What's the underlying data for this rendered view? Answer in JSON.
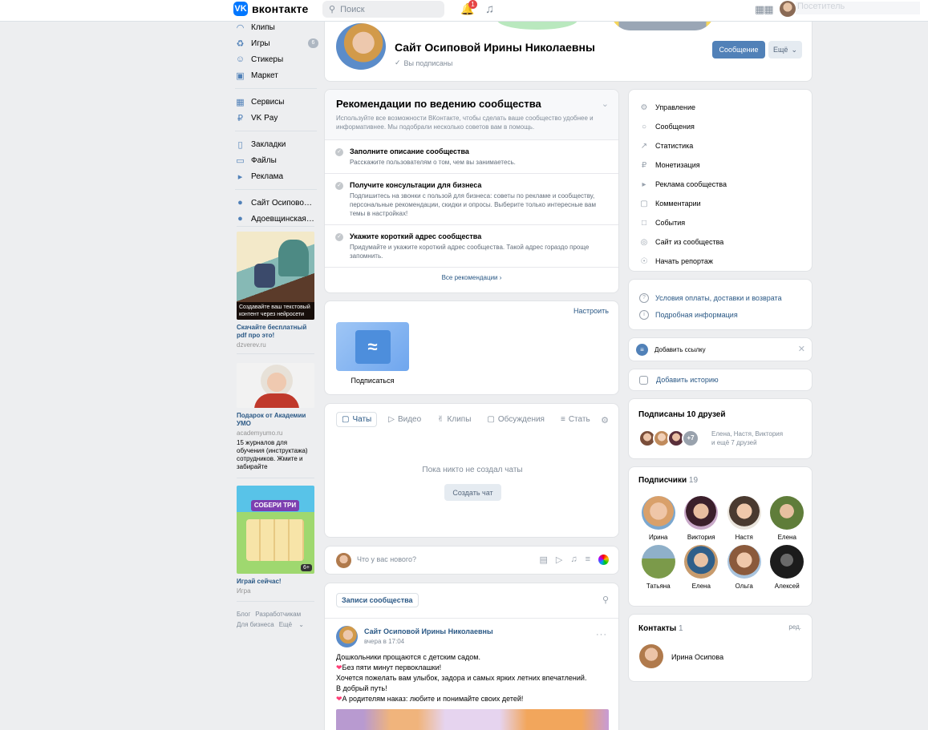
{
  "header": {
    "logo_text": "вконтакте",
    "search_placeholder": "Поиск",
    "notifications_count": "1",
    "user_name": "Посетитель"
  },
  "nav": {
    "items": [
      {
        "label": "Клипы",
        "icon": "clips-icon"
      },
      {
        "label": "Игры",
        "icon": "gamepad-icon",
        "count": "6"
      },
      {
        "label": "Стикеры",
        "icon": "smile-icon"
      },
      {
        "label": "Маркет",
        "icon": "bag-icon"
      },
      {
        "label": "Сервисы",
        "icon": "grid-icon"
      },
      {
        "label": "VK Pay",
        "icon": "pay-icon"
      },
      {
        "label": "Закладки",
        "icon": "bookmark-icon"
      },
      {
        "label": "Файлы",
        "icon": "file-icon"
      },
      {
        "label": "Реклама",
        "icon": "megaphone-icon"
      },
      {
        "label": "Сайт Осиповой Ирины Николаевны",
        "icon": "group-icon"
      },
      {
        "label": "Адоевщинская начальная школа",
        "icon": "group-icon"
      }
    ]
  },
  "ads": [
    {
      "image_caption": "Создавайте ваш текстовый контент через нейросети",
      "title": "Скачайте бесплатный pdf про это!",
      "domain": "dzverev.ru",
      "text": ""
    },
    {
      "image_caption": "",
      "title": "Подарок от Академии УМО",
      "domain": "academyumo.ru",
      "text": "15 журналов для обучения (инструктажа) сотрудников. Жмите и забирайте"
    },
    {
      "image_caption": "СОБЕРИ ТРИ",
      "badge": "6+",
      "title": "Играй сейчас!",
      "domain": "Игра",
      "text": ""
    }
  ],
  "footer": {
    "links": [
      "Блог",
      "Разработчикам",
      "Для бизнеса",
      "Ещё"
    ]
  },
  "group": {
    "name": "Сайт Осиповой Ирины Николаевны",
    "subscription_state": "Вы подписаны",
    "message_button": "Сообщение",
    "more_button": "Ещё"
  },
  "recommendations": {
    "title": "Рекомендации по ведению сообщества",
    "subtitle": "Используйте все возможности ВКонтакте, чтобы сделать ваше сообщество удобнее и информативнее. Мы подобрали несколько советов вам в помощь.",
    "items": [
      {
        "title": "Заполните описание сообщества",
        "text": "Расскажите пользователям о том, чем вы занимаетесь."
      },
      {
        "title": "Получите консультации для бизнеса",
        "text": "Подпишитесь на звонки с пользой для бизнеса: советы по рекламе и сообществу, персональные рекомендации, скидки и опросы. Выберите только интересные вам темы в настройках!"
      },
      {
        "title": "Укажите короткий адрес сообщества",
        "text": "Придумайте и укажите короткий адрес сообщества. Такой адрес гораздо проще запомнить."
      }
    ],
    "all_link": "Все рекомендации"
  },
  "widget": {
    "settings_link": "Настроить",
    "tile_label": "Подписаться"
  },
  "content_tabs": {
    "tabs": [
      {
        "label": "Чаты",
        "icon": "chat-icon",
        "active": true
      },
      {
        "label": "Видео",
        "icon": "video-icon"
      },
      {
        "label": "Клипы",
        "icon": "clips-icon"
      },
      {
        "label": "Обсуждения",
        "icon": "discussion-icon"
      },
      {
        "label": "Стать",
        "icon": "article-icon"
      }
    ],
    "empty_text": "Пока никто не создал чаты",
    "create_button": "Создать чат"
  },
  "composer": {
    "placeholder": "Что у вас нового?"
  },
  "wall": {
    "tab_label": "Записи сообщества",
    "post": {
      "author": "Сайт Осиповой Ирины Николаевны",
      "time": "вчера в 17:04",
      "lines": [
        "Дошкольники прощаются с детским садом.",
        "Без пяти минут первоклашки!",
        "Хочется пожелать вам улыбок, задора и самых ярких летних впечатлений.",
        "В добрый путь!",
        "А родителям наказ: любите и понимайте своих детей!"
      ]
    }
  },
  "management": {
    "items": [
      {
        "label": "Управление",
        "icon": "gear-icon"
      },
      {
        "label": "Сообщения",
        "icon": "message-icon"
      },
      {
        "label": "Статистика",
        "icon": "stats-icon"
      },
      {
        "label": "Монетизация",
        "icon": "coin-icon"
      },
      {
        "label": "Реклама сообщества",
        "icon": "megaphone-icon"
      },
      {
        "label": "Комментарии",
        "icon": "comment-icon"
      },
      {
        "label": "События",
        "icon": "calendar-icon"
      },
      {
        "label": "Сайт из сообщества",
        "icon": "globe-icon"
      },
      {
        "label": "Начать репортаж",
        "icon": "broadcast-icon"
      }
    ]
  },
  "info_links": [
    {
      "label": "Условия оплаты, доставки и возврата",
      "icon": "question-icon"
    },
    {
      "label": "Подробная информация",
      "icon": "info-icon"
    }
  ],
  "add_link": {
    "label": "Добавить ссылку"
  },
  "add_story": {
    "label": "Добавить историю"
  },
  "friends": {
    "title": "Подписаны 10 друзей",
    "more_count": "+7",
    "names": "Елена, Настя, Виктория",
    "names_more": "и ещё 7 друзей"
  },
  "subscribers": {
    "title": "Подписчики",
    "count": "19",
    "people": [
      "Ирина",
      "Виктория",
      "Настя",
      "Елена",
      "Татьяна",
      "Елена",
      "Ольга",
      "Алексей"
    ]
  },
  "contacts": {
    "title": "Контакты",
    "count": "1",
    "edit": "ред.",
    "name": "Ирина Осипова"
  }
}
